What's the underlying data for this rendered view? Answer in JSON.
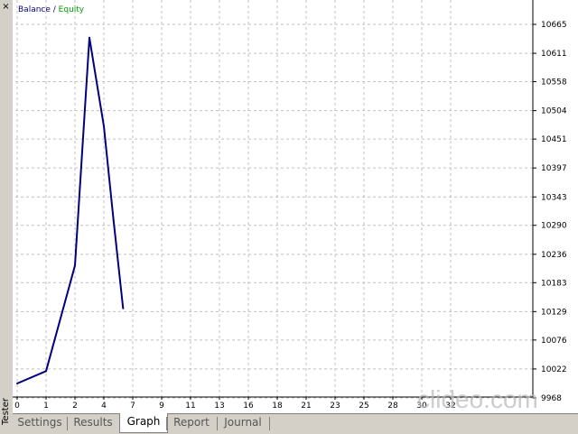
{
  "panel": {
    "title": "Tester",
    "close_glyph": "×"
  },
  "legend": {
    "balance": "Balance",
    "separator": " / ",
    "equity": "Equity"
  },
  "tabs": [
    {
      "label": "Settings",
      "active": false
    },
    {
      "label": "Results",
      "active": false
    },
    {
      "label": "Graph",
      "active": true
    },
    {
      "label": "Report",
      "active": false
    },
    {
      "label": "Journal",
      "active": false
    }
  ],
  "colors": {
    "balance": "#000080",
    "equity": "#00a000",
    "grid": "#c0c0c0"
  },
  "watermark": "clideo.com",
  "chart_data": {
    "type": "line",
    "grid": true,
    "y_axis_side": "right",
    "x_ticks": [
      0,
      1,
      2,
      4,
      7,
      9,
      11,
      13,
      16,
      18,
      21,
      23,
      25,
      28,
      30,
      32
    ],
    "y_ticks": [
      9968,
      10022,
      10076,
      10129,
      10183,
      10236,
      10290,
      10343,
      10397,
      10451,
      10504,
      10558,
      10611,
      10665
    ],
    "series": [
      {
        "name": "Balance",
        "x": [
          0,
          1,
          2,
          3,
          4,
          5,
          6
        ],
        "y": [
          9995,
          10018,
          10215,
          10640,
          10475,
          10300,
          10135
        ]
      }
    ]
  }
}
